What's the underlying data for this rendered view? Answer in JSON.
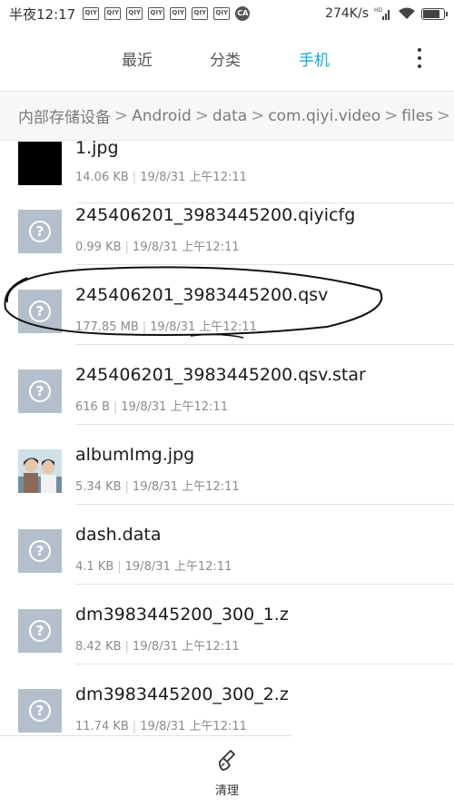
{
  "status_bar": {
    "time": "半夜12:17",
    "notifications": [
      "QIY",
      "QIY",
      "QIY",
      "QIY",
      "QIY",
      "QIY",
      "QIY"
    ],
    "notif_round": "CA",
    "network_speed": "274K/s",
    "signal_label": "HD",
    "battery_level": 0.8
  },
  "tabs": [
    {
      "label": "最近",
      "active": false
    },
    {
      "label": "分类",
      "active": false
    },
    {
      "label": "手机",
      "active": true
    }
  ],
  "breadcrumb": [
    "内部存储设备",
    "Android",
    "data",
    "com.qiyi.video",
    "files"
  ],
  "files": [
    {
      "name": "1.jpg",
      "size": "14.06 KB",
      "date": "19/8/31 上午12:11",
      "thumb": "black-image"
    },
    {
      "name": "245406201_3983445200.qiyicfg",
      "size": "0.99 KB",
      "date": "19/8/31 上午12:11",
      "thumb": "unknown"
    },
    {
      "name": "245406201_3983445200.qsv",
      "size": "177.85 MB",
      "date": "19/8/31 上午12:11",
      "thumb": "unknown"
    },
    {
      "name": "245406201_3983445200.qsv.star",
      "size": "616 B",
      "date": "19/8/31 上午12:11",
      "thumb": "unknown"
    },
    {
      "name": "albumImg.jpg",
      "size": "5.34 KB",
      "date": "19/8/31 上午12:11",
      "thumb": "photo"
    },
    {
      "name": "dash.data",
      "size": "4.1 KB",
      "date": "19/8/31 上午12:11",
      "thumb": "unknown"
    },
    {
      "name": "dm3983445200_300_1.z",
      "size": "8.42 KB",
      "date": "19/8/31 上午12:11",
      "thumb": "unknown"
    },
    {
      "name": "dm3983445200_300_2.z",
      "size": "11.74 KB",
      "date": "19/8/31 上午12:11",
      "thumb": "unknown"
    }
  ],
  "bottom": {
    "clean_label": "清理"
  },
  "colors": {
    "accent": "#17a8d6",
    "thumb": "#b3c0cb"
  }
}
